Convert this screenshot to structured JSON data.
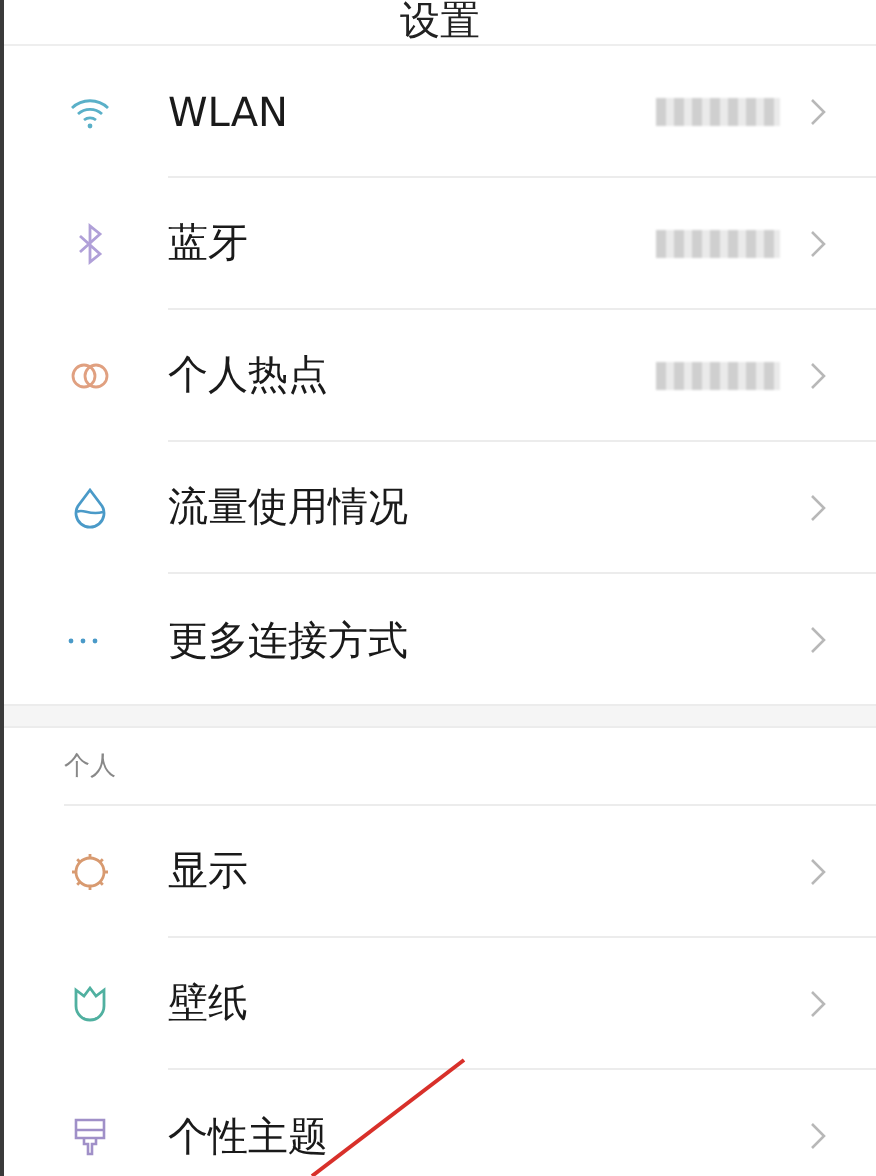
{
  "title": "设置",
  "sections": [
    {
      "items": [
        {
          "kind": "wifi",
          "label": "WLAN",
          "blurred_value": true
        },
        {
          "kind": "bluetooth",
          "label": "蓝牙",
          "blurred_value": true
        },
        {
          "kind": "rings",
          "label": "个人热点",
          "blurred_value": true
        },
        {
          "kind": "drop",
          "label": "流量使用情况",
          "blurred_value": false
        },
        {
          "kind": "dots",
          "label": "更多连接方式",
          "blurred_value": false
        }
      ]
    },
    {
      "header": "个人",
      "items": [
        {
          "kind": "sun",
          "label": "显示",
          "blurred_value": false
        },
        {
          "kind": "tulip",
          "label": "壁纸",
          "blurred_value": false
        },
        {
          "kind": "brush",
          "label": "个性主题",
          "blurred_value": false
        }
      ]
    }
  ],
  "annotation": {
    "kind": "line"
  }
}
